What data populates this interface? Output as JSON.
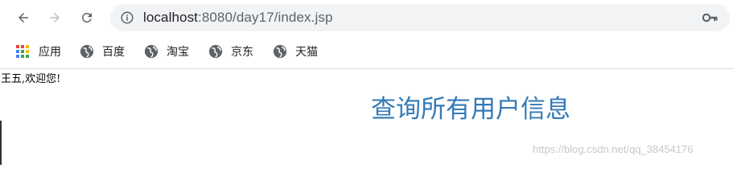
{
  "browser": {
    "url_host": "localhost",
    "url_rest": ":8080/day17/index.jsp"
  },
  "bookmarks": [
    {
      "label": "应用",
      "icon": "apps-grid-icon"
    },
    {
      "label": "百度",
      "icon": "globe-icon"
    },
    {
      "label": "淘宝",
      "icon": "globe-icon"
    },
    {
      "label": "京东",
      "icon": "globe-icon"
    },
    {
      "label": "天猫",
      "icon": "globe-icon"
    }
  ],
  "page": {
    "welcome": "王五,欢迎您!",
    "title": "查询所有用户信息",
    "watermark": "https://blog.csdn.net/qq_38454176"
  },
  "colors": {
    "title": "#337ab7",
    "omnibox_bg": "#f1f3f4"
  }
}
